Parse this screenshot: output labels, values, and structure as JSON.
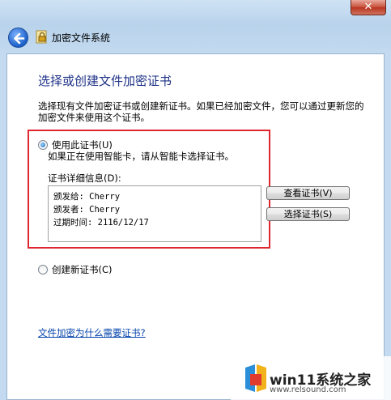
{
  "window": {
    "title": "加密文件系统",
    "close_glyph": "✕"
  },
  "page": {
    "heading": "选择或创建文件加密证书",
    "description": "选择现有文件加密证书或创建新证书。如果已经加密文件，您可以通过更新您的加密文件来使用这个证书。"
  },
  "use_cert": {
    "label": "使用此证书(U)",
    "selected": true,
    "hint": "如果正在使用智能卡，请从智能卡选择证书。",
    "details_label": "证书详细信息(D):",
    "details": [
      "颁发给: Cherry",
      "颁发者: Cherry",
      "过期时间: 2116/12/17"
    ],
    "view_button": "查看证书(V)",
    "select_button": "选择证书(S)"
  },
  "new_cert": {
    "label": "创建新证书(C)",
    "selected": false
  },
  "help_link": "文件加密为什么需要证书?",
  "watermark": {
    "brand": "win11系统之家",
    "url": "www.relsound.com"
  },
  "colors": {
    "heading": "#1e3287",
    "highlight_border": "#e0262f",
    "link": "#0645ad"
  }
}
